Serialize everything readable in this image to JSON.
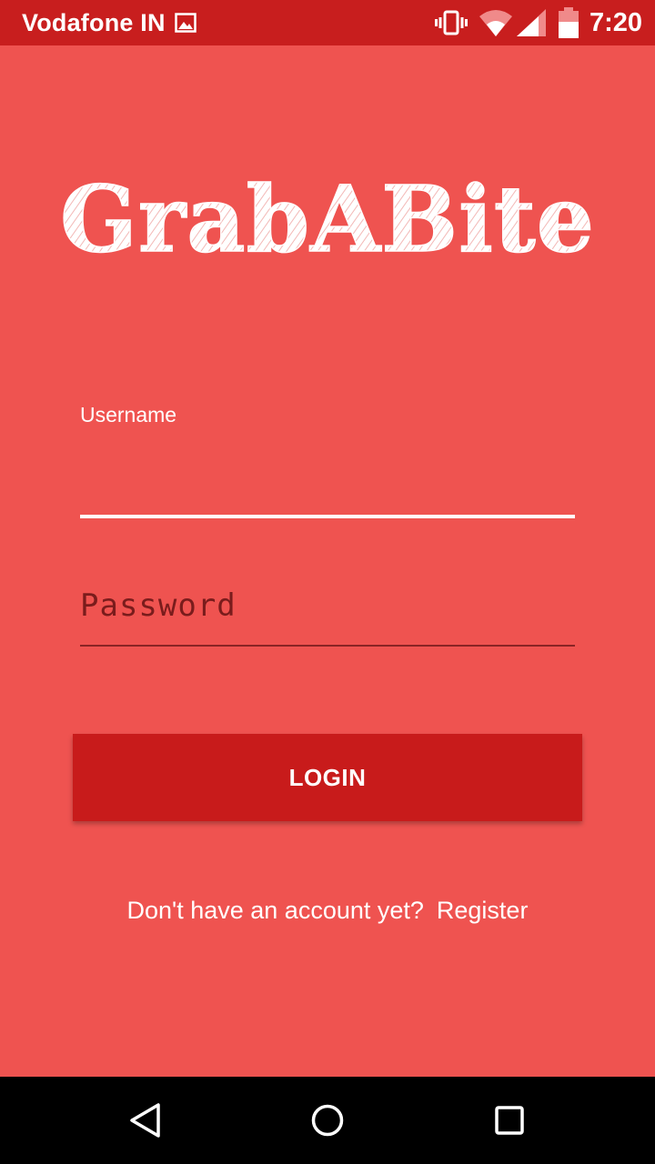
{
  "status_bar": {
    "carrier": "Vodafone IN",
    "time": "7:20",
    "icons": [
      "gallery-icon",
      "vibrate-icon",
      "wifi-icon",
      "signal-icon",
      "battery-icon"
    ],
    "background_color": "#C81E1E"
  },
  "app": {
    "logo_text": "GrabABite",
    "background_color": "#EF5350",
    "accent_color": "#C81B1B"
  },
  "login_form": {
    "username": {
      "label": "Username",
      "value": ""
    },
    "password": {
      "placeholder": "Password",
      "value": ""
    },
    "login_button_label": "LOGIN",
    "register_prompt": "Don't have an account yet?",
    "register_link": "Register"
  },
  "nav_bar": {
    "buttons": [
      "back-icon",
      "home-icon",
      "recents-icon"
    ]
  }
}
